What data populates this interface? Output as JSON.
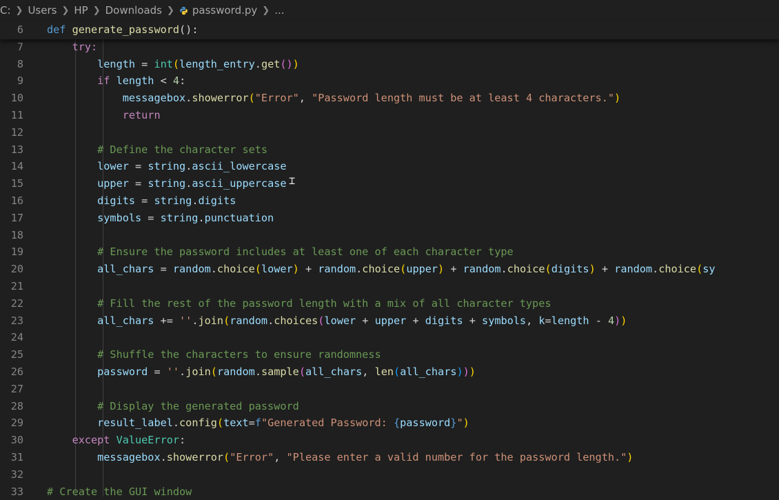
{
  "breadcrumb": {
    "items": [
      "C:",
      "Users",
      "HP",
      "Downloads"
    ],
    "file": "password.py",
    "trailing": "..."
  },
  "editor": {
    "lines": [
      {
        "n": "6",
        "code": [
          {
            "t": "def ",
            "c": "kw"
          },
          {
            "t": "generate_password",
            "c": "fn"
          },
          {
            "t": "():",
            "c": "pun"
          }
        ]
      },
      {
        "n": "7",
        "code": [
          {
            "t": "    try:",
            "c": "ctl"
          }
        ]
      },
      {
        "n": "8",
        "code": [
          {
            "t": "        length",
            "c": "var"
          },
          {
            "t": " = ",
            "c": "pun"
          },
          {
            "t": "int",
            "c": "cls"
          },
          {
            "t": "(",
            "c": "b1"
          },
          {
            "t": "length_entry",
            "c": "var"
          },
          {
            "t": ".",
            "c": "pun"
          },
          {
            "t": "get",
            "c": "fn"
          },
          {
            "t": "()",
            "c": "b2"
          },
          {
            "t": ")",
            "c": "b1"
          }
        ]
      },
      {
        "n": "9",
        "code": [
          {
            "t": "        if ",
            "c": "ctl"
          },
          {
            "t": "length",
            "c": "var"
          },
          {
            "t": " < ",
            "c": "pun"
          },
          {
            "t": "4",
            "c": "num"
          },
          {
            "t": ":",
            "c": "pun"
          }
        ]
      },
      {
        "n": "10",
        "code": [
          {
            "t": "            messagebox",
            "c": "var"
          },
          {
            "t": ".",
            "c": "pun"
          },
          {
            "t": "showerror",
            "c": "fn"
          },
          {
            "t": "(",
            "c": "b1"
          },
          {
            "t": "\"Error\"",
            "c": "str"
          },
          {
            "t": ", ",
            "c": "pun"
          },
          {
            "t": "\"Password length must be at least 4 characters.\"",
            "c": "str"
          },
          {
            "t": ")",
            "c": "b1"
          }
        ]
      },
      {
        "n": "11",
        "code": [
          {
            "t": "            return",
            "c": "ctl"
          }
        ]
      },
      {
        "n": "12",
        "code": []
      },
      {
        "n": "13",
        "code": [
          {
            "t": "        # Define the character sets",
            "c": "cmt"
          }
        ]
      },
      {
        "n": "14",
        "code": [
          {
            "t": "        lower",
            "c": "var"
          },
          {
            "t": " = ",
            "c": "pun"
          },
          {
            "t": "string",
            "c": "var"
          },
          {
            "t": ".",
            "c": "pun"
          },
          {
            "t": "ascii_lowercase",
            "c": "var"
          }
        ]
      },
      {
        "n": "15",
        "code": [
          {
            "t": "        upper",
            "c": "var"
          },
          {
            "t": " = ",
            "c": "pun"
          },
          {
            "t": "string",
            "c": "var"
          },
          {
            "t": ".",
            "c": "pun"
          },
          {
            "t": "ascii_uppercase",
            "c": "var"
          }
        ]
      },
      {
        "n": "16",
        "code": [
          {
            "t": "        digits",
            "c": "var"
          },
          {
            "t": " = ",
            "c": "pun"
          },
          {
            "t": "string",
            "c": "var"
          },
          {
            "t": ".",
            "c": "pun"
          },
          {
            "t": "digits",
            "c": "var"
          }
        ]
      },
      {
        "n": "17",
        "code": [
          {
            "t": "        symbols",
            "c": "var"
          },
          {
            "t": " = ",
            "c": "pun"
          },
          {
            "t": "string",
            "c": "var"
          },
          {
            "t": ".",
            "c": "pun"
          },
          {
            "t": "punctuation",
            "c": "var"
          }
        ]
      },
      {
        "n": "18",
        "code": []
      },
      {
        "n": "19",
        "code": [
          {
            "t": "        # Ensure the password includes at least one of each character type",
            "c": "cmt"
          }
        ]
      },
      {
        "n": "20",
        "code": [
          {
            "t": "        all_chars",
            "c": "var"
          },
          {
            "t": " = ",
            "c": "pun"
          },
          {
            "t": "random",
            "c": "var"
          },
          {
            "t": ".",
            "c": "pun"
          },
          {
            "t": "choice",
            "c": "fn"
          },
          {
            "t": "(",
            "c": "b1"
          },
          {
            "t": "lower",
            "c": "var"
          },
          {
            "t": ")",
            "c": "b1"
          },
          {
            "t": " + ",
            "c": "pun"
          },
          {
            "t": "random",
            "c": "var"
          },
          {
            "t": ".",
            "c": "pun"
          },
          {
            "t": "choice",
            "c": "fn"
          },
          {
            "t": "(",
            "c": "b1"
          },
          {
            "t": "upper",
            "c": "var"
          },
          {
            "t": ")",
            "c": "b1"
          },
          {
            "t": " + ",
            "c": "pun"
          },
          {
            "t": "random",
            "c": "var"
          },
          {
            "t": ".",
            "c": "pun"
          },
          {
            "t": "choice",
            "c": "fn"
          },
          {
            "t": "(",
            "c": "b1"
          },
          {
            "t": "digits",
            "c": "var"
          },
          {
            "t": ")",
            "c": "b1"
          },
          {
            "t": " + ",
            "c": "pun"
          },
          {
            "t": "random",
            "c": "var"
          },
          {
            "t": ".",
            "c": "pun"
          },
          {
            "t": "choice",
            "c": "fn"
          },
          {
            "t": "(",
            "c": "b1"
          },
          {
            "t": "sy",
            "c": "var"
          }
        ]
      },
      {
        "n": "21",
        "code": []
      },
      {
        "n": "22",
        "code": [
          {
            "t": "        # Fill the rest of the password length with a mix of all character types",
            "c": "cmt"
          }
        ]
      },
      {
        "n": "23",
        "code": [
          {
            "t": "        all_chars",
            "c": "var"
          },
          {
            "t": " += ",
            "c": "pun"
          },
          {
            "t": "''",
            "c": "str"
          },
          {
            "t": ".",
            "c": "pun"
          },
          {
            "t": "join",
            "c": "fn"
          },
          {
            "t": "(",
            "c": "b1"
          },
          {
            "t": "random",
            "c": "var"
          },
          {
            "t": ".",
            "c": "pun"
          },
          {
            "t": "choices",
            "c": "fn"
          },
          {
            "t": "(",
            "c": "b2"
          },
          {
            "t": "lower",
            "c": "var"
          },
          {
            "t": " + ",
            "c": "pun"
          },
          {
            "t": "upper",
            "c": "var"
          },
          {
            "t": " + ",
            "c": "pun"
          },
          {
            "t": "digits",
            "c": "var"
          },
          {
            "t": " + ",
            "c": "pun"
          },
          {
            "t": "symbols",
            "c": "var"
          },
          {
            "t": ", ",
            "c": "pun"
          },
          {
            "t": "k",
            "c": "var"
          },
          {
            "t": "=",
            "c": "pun"
          },
          {
            "t": "length",
            "c": "var"
          },
          {
            "t": " - ",
            "c": "pun"
          },
          {
            "t": "4",
            "c": "num"
          },
          {
            "t": ")",
            "c": "b2"
          },
          {
            "t": ")",
            "c": "b1"
          }
        ]
      },
      {
        "n": "24",
        "code": []
      },
      {
        "n": "25",
        "code": [
          {
            "t": "        # Shuffle the characters to ensure randomness",
            "c": "cmt"
          }
        ]
      },
      {
        "n": "26",
        "code": [
          {
            "t": "        password",
            "c": "var"
          },
          {
            "t": " = ",
            "c": "pun"
          },
          {
            "t": "''",
            "c": "str"
          },
          {
            "t": ".",
            "c": "pun"
          },
          {
            "t": "join",
            "c": "fn"
          },
          {
            "t": "(",
            "c": "b1"
          },
          {
            "t": "random",
            "c": "var"
          },
          {
            "t": ".",
            "c": "pun"
          },
          {
            "t": "sample",
            "c": "fn"
          },
          {
            "t": "(",
            "c": "b2"
          },
          {
            "t": "all_chars",
            "c": "var"
          },
          {
            "t": ", ",
            "c": "pun"
          },
          {
            "t": "len",
            "c": "fn"
          },
          {
            "t": "(",
            "c": "b3"
          },
          {
            "t": "all_chars",
            "c": "var"
          },
          {
            "t": ")",
            "c": "b3"
          },
          {
            "t": ")",
            "c": "b2"
          },
          {
            "t": ")",
            "c": "b1"
          }
        ]
      },
      {
        "n": "27",
        "code": []
      },
      {
        "n": "28",
        "code": [
          {
            "t": "        # Display the generated password",
            "c": "cmt"
          }
        ]
      },
      {
        "n": "29",
        "code": [
          {
            "t": "        result_label",
            "c": "var"
          },
          {
            "t": ".",
            "c": "pun"
          },
          {
            "t": "config",
            "c": "fn"
          },
          {
            "t": "(",
            "c": "b1"
          },
          {
            "t": "text",
            "c": "var"
          },
          {
            "t": "=",
            "c": "pun"
          },
          {
            "t": "f",
            "c": "kw"
          },
          {
            "t": "\"Generated Password: ",
            "c": "str"
          },
          {
            "t": "{",
            "c": "kw"
          },
          {
            "t": "password",
            "c": "var"
          },
          {
            "t": "}",
            "c": "kw"
          },
          {
            "t": "\"",
            "c": "str"
          },
          {
            "t": ")",
            "c": "b1"
          }
        ]
      },
      {
        "n": "30",
        "code": [
          {
            "t": "    except ",
            "c": "ctl"
          },
          {
            "t": "ValueError",
            "c": "cls"
          },
          {
            "t": ":",
            "c": "pun"
          }
        ]
      },
      {
        "n": "31",
        "code": [
          {
            "t": "        messagebox",
            "c": "var"
          },
          {
            "t": ".",
            "c": "pun"
          },
          {
            "t": "showerror",
            "c": "fn"
          },
          {
            "t": "(",
            "c": "b1"
          },
          {
            "t": "\"Error\"",
            "c": "str"
          },
          {
            "t": ", ",
            "c": "pun"
          },
          {
            "t": "\"Please enter a valid number for the password length.\"",
            "c": "str"
          },
          {
            "t": ")",
            "c": "b1"
          }
        ]
      },
      {
        "n": "32",
        "code": []
      },
      {
        "n": "33",
        "code": [
          {
            "t": "# Create the GUI window",
            "c": "cmt"
          }
        ]
      }
    ]
  },
  "icons": {
    "file_icon": "python-file-icon",
    "cursor": "text-cursor-icon"
  },
  "colors": {
    "background": "#1f1f1f",
    "keyword": "#569cd6",
    "control": "#c586c0",
    "function": "#dcdcaa",
    "variable": "#9cdcfe",
    "string": "#ce9178",
    "number": "#b5cea8",
    "comment": "#6a9955",
    "class": "#4ec9b0"
  }
}
